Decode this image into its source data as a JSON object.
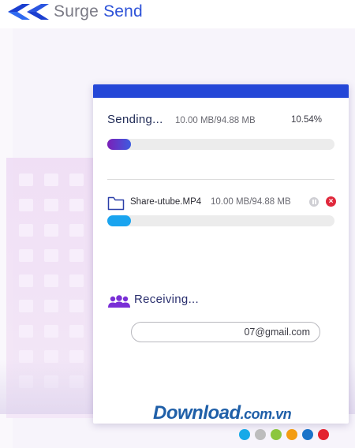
{
  "app": {
    "logo_word1": "Surge",
    "logo_word2": "Send"
  },
  "sending": {
    "title": "Sending...",
    "size": "10.00 MB/94.88 MB",
    "percent_text": "10.54%",
    "progress": 0.1054
  },
  "file": {
    "name": "Share-utube.MP4",
    "size": "10.00 MB/94.88 MB",
    "progress": 0.1054,
    "icon": "folder-icon"
  },
  "receiving": {
    "title": "Receiving...",
    "email_value": "07@gmail.com",
    "icon": "users-icon"
  },
  "watermark": {
    "brand": "Download",
    "suffix": ".com.vn"
  },
  "colors": {
    "accent": "#2447d7",
    "sending_gradient": [
      "#7b1fb8",
      "#3d5ce0"
    ],
    "file_progress": "#1aa4ef",
    "receive_icon": "#7a2fd6",
    "dots": [
      "#17a9e8",
      "#bdbdbd",
      "#8cc63e",
      "#f39c12",
      "#1a73c9",
      "#e3232f"
    ]
  }
}
